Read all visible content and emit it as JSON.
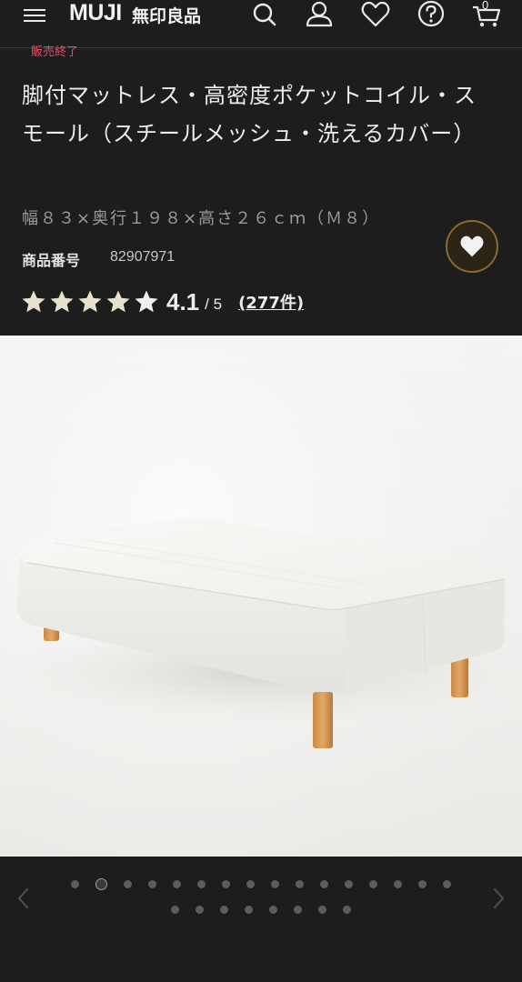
{
  "header": {
    "brand_latin": "MUJI",
    "brand_kanji": "無印良品",
    "icons": [
      "menu-icon",
      "search-icon",
      "account-icon",
      "heart-icon",
      "help-icon",
      "cart-icon"
    ],
    "cart_count": "0"
  },
  "product": {
    "status_label": "販売終了",
    "title": "脚付マットレス・高密度ポケットコイル・スモール（スチールメッシュ・洗えるカバー）",
    "size": "幅８３×奥行１９８×高さ２６ｃｍ（Ｍ８）",
    "product_number_label": "商品番号",
    "product_number": "82907971",
    "rating": {
      "value": "4.1",
      "max": "/ 5",
      "review_count": "(277件)",
      "stars": 5
    }
  },
  "gallery": {
    "image_description_icon": "bed-mattress-photo",
    "total_slides": 24,
    "active_index": 1,
    "prev_icon": "chevron-left-icon",
    "next_icon": "chevron-right-icon"
  },
  "colors": {
    "background": "#1d1d1d",
    "accent_gold": "#8a6a2e",
    "soldout_red": "#e8506a",
    "star": "#e8e2cc"
  }
}
